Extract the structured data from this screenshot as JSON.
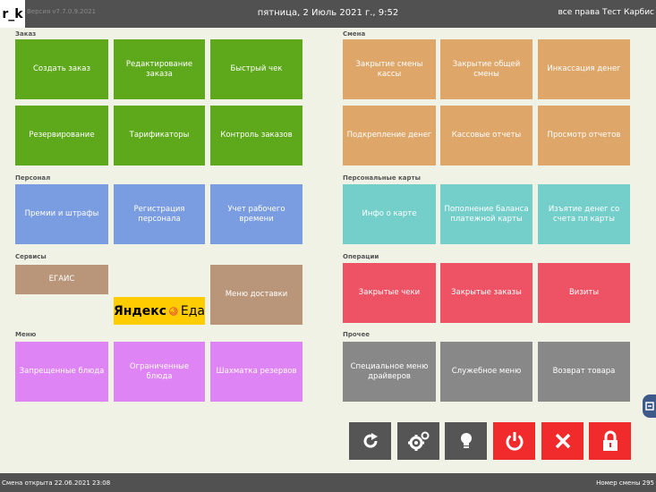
{
  "header": {
    "logo": "r_k",
    "version": "Версия v7.7.0.9.2021",
    "datetime": "пятница, 2 Июль 2021 г., 9:52",
    "copyright": "все права Тест Карбис"
  },
  "footer": {
    "shift_open": "Смена открыта 22.06.2021 23:08",
    "shift_number": "Номер смены 295"
  },
  "sections": {
    "order": "Заказ",
    "shift": "Смена",
    "staff": "Персонал",
    "cards": "Персональные карты",
    "services": "Сервисы",
    "operations": "Операции",
    "menu": "Меню",
    "other": "Прочее"
  },
  "tiles": {
    "create_order": "Создать заказ",
    "edit_order": "Редактирование заказа",
    "quick_check": "Быстрый чек",
    "reservation": "Резервирование",
    "tariffs": "Тарификаторы",
    "order_control": "Контроль заказов",
    "close_cash_shift": "Закрытие смены кассы",
    "close_general_shift": "Закрытие общей смены",
    "cash_collection": "Инкассация денег",
    "cash_reinforce": "Подкрепление денег",
    "cash_reports": "Кассовые отчеты",
    "view_reports": "Просмотр отчетов",
    "bonuses_fines": "Премии и штрафы",
    "staff_registration": "Регистрация персонала",
    "work_time": "Учет рабочего времени",
    "card_info": "Инфо о карте",
    "topup_balance": "Пополнение баланса платежной карты",
    "withdraw_money": "Изъятие денег со счета пл карты",
    "egais": "ЕГАИС",
    "delivery_menu": "Меню доставки",
    "closed_checks": "Закрытые чеки",
    "closed_orders": "Закрытые заказы",
    "visits": "Визиты",
    "forbidden_dishes": "Запрещенные блюда",
    "limited_dishes": "Ограниченные блюда",
    "reserve_chess": "Шахматка резервов",
    "driver_menu": "Специальное меню драйверов",
    "service_menu": "Служебное меню",
    "return_goods": "Возврат товара"
  },
  "yandex": {
    "brand": "Яндекс",
    "eda": "Еда"
  },
  "icons": {
    "refresh": "refresh-icon",
    "settings": "gears-icon",
    "hint": "lightbulb-icon",
    "power": "power-icon",
    "close": "close-icon",
    "lock": "lock-icon"
  },
  "colors": {
    "green": "#5ea81b",
    "orange": "#dfa669",
    "blue": "#7a9ce1",
    "teal": "#74cfcb",
    "brown": "#b9967a",
    "red": "#ed5265",
    "pink": "#de84f5",
    "gray": "#888888",
    "action_red": "#f12b2b",
    "action_gray": "#555555"
  }
}
